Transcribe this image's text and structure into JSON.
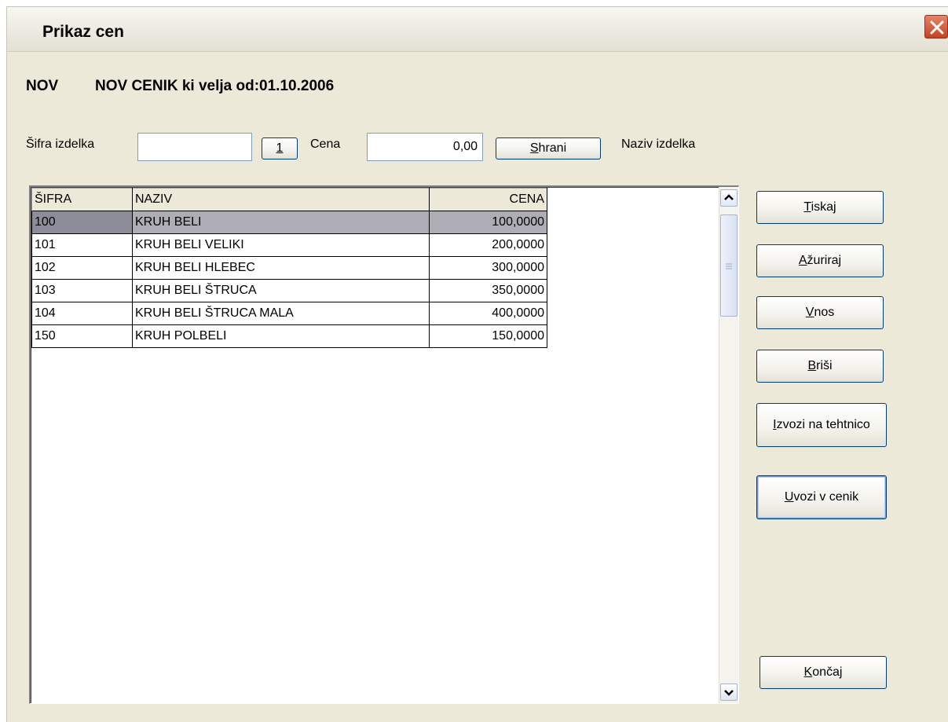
{
  "window": {
    "title": "Prikaz cen"
  },
  "header": {
    "code": "NOV",
    "text": "NOV CENIK ki velja od:01.10.2006"
  },
  "form": {
    "sifra_label": "Šifra izdelka",
    "sifra_value": "",
    "lookup_button": "1",
    "cena_label": "Cena",
    "cena_value": "0,00",
    "save_button": "Shrani",
    "naziv_label": "Naziv izdelka"
  },
  "grid": {
    "columns": [
      "ŠIFRA",
      "NAZIV",
      "CENA"
    ],
    "rows": [
      [
        "100",
        "KRUH BELI",
        "100,0000"
      ],
      [
        "101",
        "KRUH BELI VELIKI",
        "200,0000"
      ],
      [
        "102",
        "KRUH BELI HLEBEC",
        "300,0000"
      ],
      [
        "103",
        "KRUH BELI ŠTRUCA",
        "350,0000"
      ],
      [
        "104",
        "KRUH BELI ŠTRUCA MALA",
        "400,0000"
      ],
      [
        "150",
        "KRUH POLBELI",
        "150,0000"
      ]
    ],
    "selected_row": 0
  },
  "actions": {
    "print": "Tiskaj",
    "update": "Ažuriraj",
    "entry": "Vnos",
    "delete": "Briši",
    "export": "Izvozi na tehtnico",
    "import": "Uvozi v cenik",
    "finish": "Končaj"
  },
  "icons": {
    "close": "close-icon",
    "scroll_up": "arrow-up-icon",
    "scroll_down": "arrow-down-icon",
    "thumb_grip": "grip-icon"
  }
}
